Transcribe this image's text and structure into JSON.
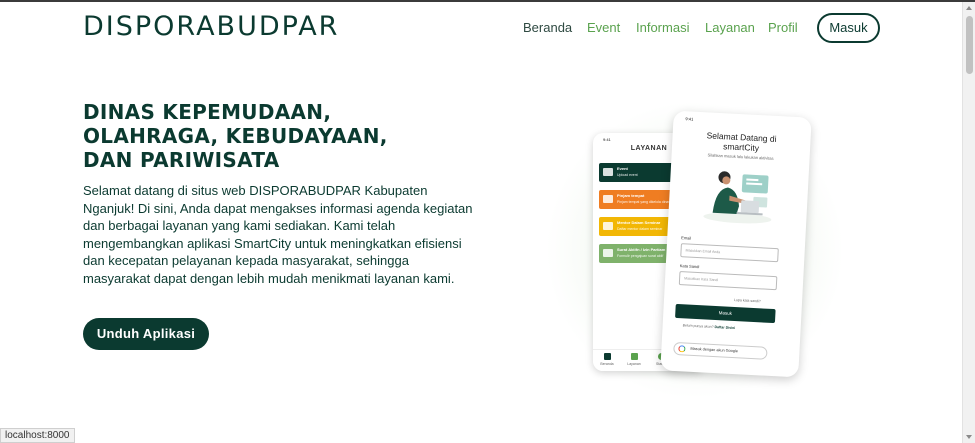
{
  "header": {
    "logo": "DISPORABUDPAR",
    "nav": [
      {
        "label": "Beranda",
        "active": true
      },
      {
        "label": "Event",
        "active": false
      },
      {
        "label": "Informasi",
        "active": false
      },
      {
        "label": "Layanan",
        "active": false
      },
      {
        "label": "Profil",
        "active": false
      }
    ],
    "login_label": "Masuk"
  },
  "hero": {
    "title_lines": [
      "DINAS KEPEMUDAAN,",
      "OLAHRAGA, KEBUDAYAAN,",
      "DAN PARIWISATA"
    ],
    "description": "Selamat datang di situs web DISPORABUDPAR Kabupaten Nganjuk! Di sini, Anda dapat mengakses informasi agenda kegiatan dan berbagai layanan yang kami sediakan. Kami telah mengembangkan aplikasi SmartCity untuk meningkatkan efisiensi dan kecepatan pelayanan kepada masyarakat, sehingga masyarakat dapat dengan lebih mudah menikmati layanan kami.",
    "download_label": "Unduh Aplikasi"
  },
  "phone_layanan": {
    "time": "9:41",
    "heading": "LAYANAN",
    "cards": [
      {
        "title": "Event",
        "subtitle": "Upload event",
        "color": "#0b3a30"
      },
      {
        "title": "Pinjam tempat",
        "subtitle": "Pinjam tempat yang dikelola dinas",
        "color": "#ef7d22"
      },
      {
        "title": "Mentor Dalam Seminar",
        "subtitle": "Daftar mentor dalam seminar",
        "color": "#f2b705"
      },
      {
        "title": "Surat Aktifn / Izin Partiam",
        "subtitle": "Formulir pengajuan surat aktif",
        "color": "#7fb26b"
      }
    ],
    "bottom_nav": [
      "Beranda",
      "Layanan",
      "Status",
      "Akun"
    ]
  },
  "phone_login": {
    "time": "9:41",
    "title_line1": "Selamat Datang di",
    "title_line2": "smartCity",
    "subtitle": "Silahkan masuk lalu lakukan aktivitas",
    "email_label": "Email",
    "email_placeholder": "Masukkan Email Anda",
    "password_label": "Kata Sandi",
    "password_placeholder": "Masukkan Kata Sandi",
    "forgot": "Lupa kata sandi?",
    "login_button": "Masuk",
    "register_prompt": "Belum punya akun?",
    "register_link": "Daftar Disini",
    "google_button": "Masuk dengan akun Google"
  },
  "status_bar": {
    "url": "localhost:8000"
  },
  "colors": {
    "primary": "#0b3a30",
    "nav_green": "#5aa24e"
  }
}
